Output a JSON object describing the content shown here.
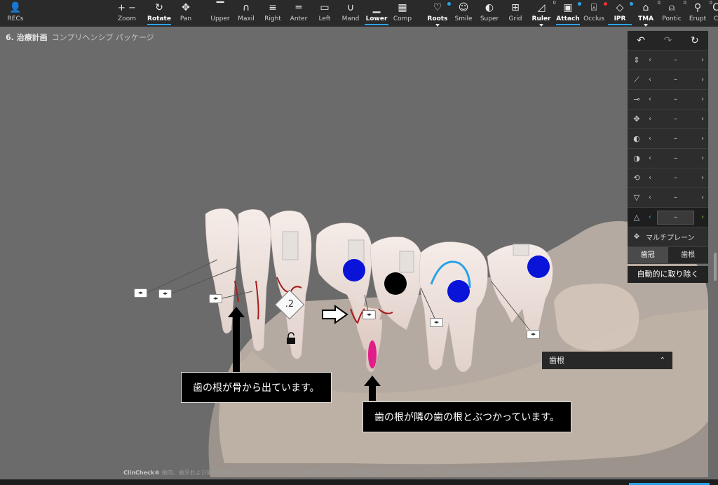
{
  "toolbar": {
    "items": [
      {
        "label": "RECs",
        "icon": "user-icon"
      },
      {
        "label": "Zoom",
        "icon": "zoom-icon"
      },
      {
        "label": "Rotate",
        "icon": "rotate-icon",
        "selected": true
      },
      {
        "label": "Pan",
        "icon": "pan-icon"
      },
      {
        "label": "Upper",
        "icon": "upper-icon"
      },
      {
        "label": "Maxil",
        "icon": "maxil-icon"
      },
      {
        "label": "Right",
        "icon": "right-icon"
      },
      {
        "label": "Anter",
        "icon": "anter-icon"
      },
      {
        "label": "Left",
        "icon": "left-icon"
      },
      {
        "label": "Mand",
        "icon": "mand-icon"
      },
      {
        "label": "Lower",
        "icon": "lower-icon",
        "selected": true
      },
      {
        "label": "Comp",
        "icon": "comp-icon"
      },
      {
        "label": "Roots",
        "icon": "roots-icon",
        "selected": true
      },
      {
        "label": "Smile",
        "icon": "smile-icon"
      },
      {
        "label": "Super",
        "icon": "super-icon"
      },
      {
        "label": "Grid",
        "icon": "grid-icon"
      },
      {
        "label": "Ruler",
        "icon": "ruler-icon",
        "selected": true
      },
      {
        "label": "Attach",
        "icon": "attach-icon",
        "selected": true
      },
      {
        "label": "Occlus",
        "icon": "occlus-icon"
      },
      {
        "label": "IPR",
        "icon": "ipr-icon",
        "selected": true
      },
      {
        "label": "TMA",
        "icon": "tma-icon",
        "selected": true
      },
      {
        "label": "Pontic",
        "icon": "pontic-icon"
      },
      {
        "label": "Erupt",
        "icon": "erupt-icon"
      },
      {
        "label": "C",
        "icon": "more-icon"
      }
    ],
    "badge_zero": "0"
  },
  "breadcrumb": {
    "step": "6. 治療計画",
    "subtitle": "コンプリヘンシブ パッケージ"
  },
  "panel": {
    "nav": {
      "undo": "↶",
      "redo": "↷",
      "reset": "↻"
    },
    "rows": [
      {
        "icon": "extrusion-icon",
        "glyph": "⇕",
        "value": "–"
      },
      {
        "icon": "angulation-icon",
        "glyph": "⟋",
        "value": "–"
      },
      {
        "icon": "inclination-icon",
        "glyph": "⊸",
        "value": "–"
      },
      {
        "icon": "translation-icon",
        "glyph": "✥",
        "value": "–"
      },
      {
        "icon": "buccal-icon",
        "glyph": "◐",
        "value": "–"
      },
      {
        "icon": "mesial-icon",
        "glyph": "◑",
        "value": "–"
      },
      {
        "icon": "rotation-icon",
        "glyph": "⟲",
        "value": "–"
      },
      {
        "icon": "torque-icon",
        "glyph": "▽",
        "value": "–"
      },
      {
        "icon": "root-movement-icon",
        "glyph": "△",
        "value": "–",
        "active": true
      }
    ],
    "arrow_left": "‹",
    "arrow_right": "›",
    "multiplane": "マルチプレーン",
    "segments": [
      "歯冠",
      "歯根"
    ],
    "auto_remove": "自動的に取り除く"
  },
  "root_dropdown": {
    "label": "歯根",
    "chevron": "⌃"
  },
  "callouts": {
    "bone": "歯の根が骨から出ています。",
    "collision": "歯の根が隣の歯の根とぶつかっています。"
  },
  "ipr_value": ".2",
  "footer": {
    "brand": "ClinCheck®",
    "text": " 歯肉、歯牙および歯根移動のシミュレーションであり、歯根等のレンダリング画像は目安としてのイメージです。実際の臨床結果とは異なる場合があります"
  }
}
